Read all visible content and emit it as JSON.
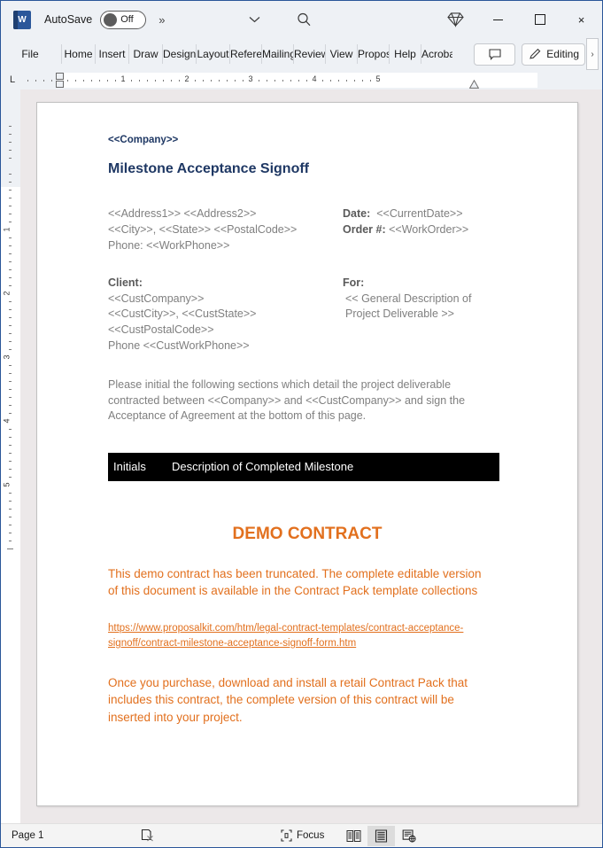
{
  "window": {
    "app_logo": "word-logo",
    "app_logo_letter": "W",
    "autosave_label": "AutoSave",
    "autosave_state": "Off",
    "overflow_chevron": "»",
    "ribbon_display_chevron": "chevron-down-icon",
    "search_icon": "search-icon",
    "premium_icon": "diamond-icon",
    "minimize": "minimize-icon",
    "maximize": "maximize-icon",
    "close": "×"
  },
  "ribbon": {
    "tabs": [
      {
        "label": "File"
      },
      {
        "label": "Home"
      },
      {
        "label": "Insert"
      },
      {
        "label": "Draw"
      },
      {
        "label": "Design"
      },
      {
        "label": "Layout"
      },
      {
        "label": "References"
      },
      {
        "label": "Mailings"
      },
      {
        "label": "Review"
      },
      {
        "label": "View"
      },
      {
        "label": "Proposal"
      },
      {
        "label": "Help"
      },
      {
        "label": "Acrobat"
      }
    ],
    "comment_button": "comment-icon",
    "editing_label": "Editing",
    "editing_icon": "pencil-icon",
    "overflow_label": "›"
  },
  "ruler": {
    "horizontal_numbers": [
      "1",
      "2",
      "3",
      "4",
      "5"
    ],
    "vertical_numbers": [
      "1",
      "2",
      "3",
      "4",
      "5"
    ],
    "tab_stop_marker": "L"
  },
  "document": {
    "company": "<<Company>>",
    "title": "Milestone Acceptance Signoff",
    "address": {
      "line1": "<<Address1>> <<Address2>>",
      "line2": "<<City>>, <<State>> <<PostalCode>>",
      "line3": "Phone: <<WorkPhone>>"
    },
    "meta": {
      "date_label": "Date:",
      "date_value": "<<CurrentDate>>",
      "order_label": "Order #:",
      "order_value": "<<WorkOrder>>"
    },
    "client": {
      "heading": "Client:",
      "line1": "<<CustCompany>>",
      "line2": "<<CustCity>>, <<CustState>>",
      "line3": "<<CustPostalCode>>",
      "line4": "Phone <<CustWorkPhone>>"
    },
    "for": {
      "heading": "For:",
      "line1": "<< General Description of",
      "line2": "Project Deliverable >>"
    },
    "intro_paragraph": "Please initial the following sections which detail the project deliverable contracted between <<Company>> and <<CustCompany>> and sign the Acceptance of Agreement at the bottom of this page.",
    "table_header": {
      "col1": "Initials",
      "col2": "Description of Completed Milestone"
    },
    "demo": {
      "title": "DEMO CONTRACT",
      "paragraph1": "This demo contract has been truncated. The complete editable version of this document is available in the Contract Pack template collections",
      "link": "https://www.proposalkit.com/htm/legal-contract-templates/contract-acceptance-signoff/contract-milestone-acceptance-signoff-form.htm",
      "paragraph2": "Once you purchase, download and install a retail Contract Pack that includes this contract, the complete version of this contract will be inserted into your project."
    }
  },
  "statusbar": {
    "page_label": "Page 1",
    "proofing_icon": "proofing-errors-icon",
    "focus_label": "Focus",
    "focus_icon": "focus-icon",
    "view_read": "read-mode-icon",
    "view_print": "print-layout-icon",
    "view_web": "web-layout-icon"
  },
  "colors": {
    "heading_navy": "#1f3864",
    "body_gray": "#7f7f7f",
    "accent_orange": "#E2701E",
    "table_header_bg": "#000000",
    "word_blue": "#2b579a"
  }
}
